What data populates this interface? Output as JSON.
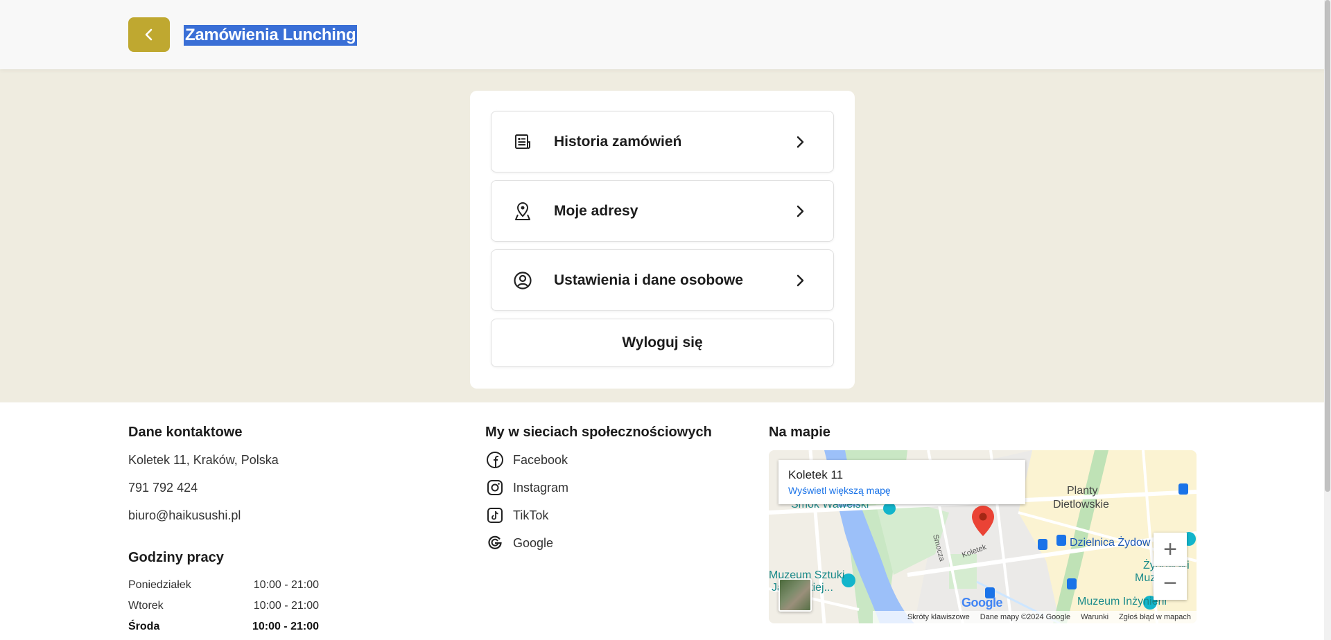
{
  "header": {
    "title": "Zamówienia Lunching",
    "back_icon": "chevron-left-icon",
    "accent_color": "#bfa830"
  },
  "menu": {
    "items": [
      {
        "label": "Historia zamówień",
        "icon": "receipt-list-icon"
      },
      {
        "label": "Moje adresy",
        "icon": "map-pin-icon"
      },
      {
        "label": "Ustawienia i dane osobowe",
        "icon": "user-circle-icon"
      }
    ],
    "logout_label": "Wyloguj się"
  },
  "footer": {
    "contact": {
      "heading": "Dane kontaktowe",
      "address": "Koletek 11, Kraków, Polska",
      "phone": "791 792 424",
      "email": "biuro@haikusushi.pl"
    },
    "hours": {
      "heading": "Godziny pracy",
      "rows": [
        {
          "day": "Poniedziałek",
          "time": "10:00 - 21:00"
        },
        {
          "day": "Wtorek",
          "time": "10:00 - 21:00"
        },
        {
          "day": "Środa",
          "time": "10:00 - 21:00"
        }
      ]
    },
    "social": {
      "heading": "My w sieciach społecznościowych",
      "items": [
        {
          "label": "Facebook",
          "icon": "facebook-icon"
        },
        {
          "label": "Instagram",
          "icon": "instagram-icon"
        },
        {
          "label": "TikTok",
          "icon": "tiktok-icon"
        },
        {
          "label": "Google",
          "icon": "google-icon"
        }
      ]
    },
    "map": {
      "heading": "Na mapie",
      "info_title": "Koletek 11",
      "info_link": "Wyświetl większą mapę",
      "labels": {
        "planty": "Planty",
        "dietlowskie": "Dietlowskie",
        "kazimierz": "Dzielnica Żydow",
        "muzeum_sztuki": "Muzeum Sztuki",
        "japonskiej": "Japońskiej...",
        "muzeum_inz": "Muzeum Inżynierii",
        "smok": "Smok Wawelski",
        "koletek": "Koletek",
        "smocza": "Smocza",
        "zydowskie": "Żydowski",
        "muzeum_short": "Muzeum"
      },
      "footer_items": [
        "Skróty klawiszowe",
        "Dane mapy ©2024 Google",
        "Warunki",
        "Zgłoś błąd w mapach"
      ],
      "zoom_in": "+",
      "zoom_out": "−",
      "brand": "Google"
    }
  }
}
